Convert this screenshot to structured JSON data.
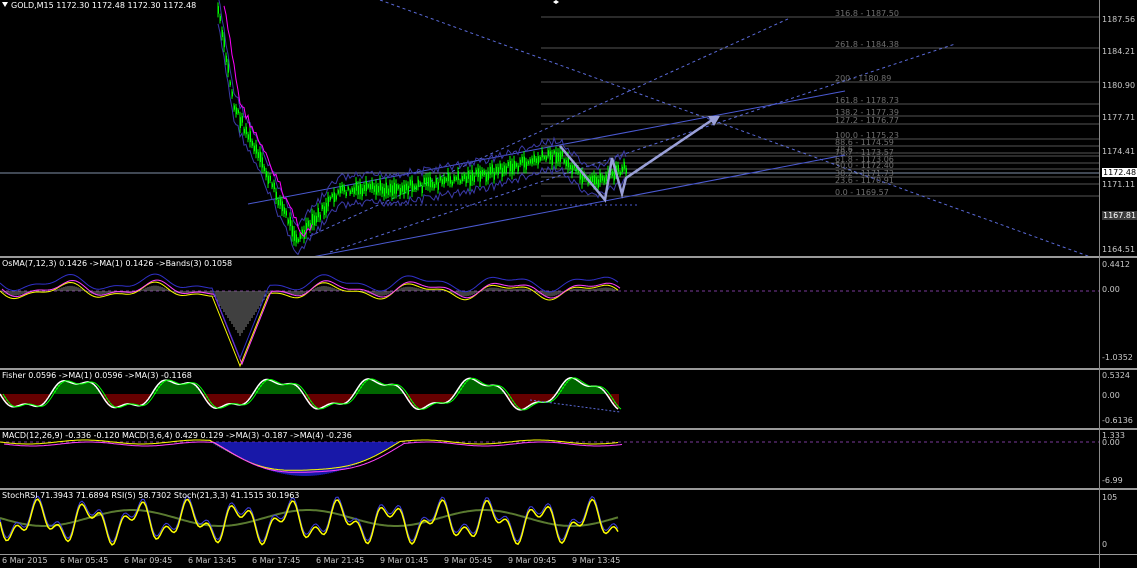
{
  "main": {
    "title": "GOLD,M15  1172.30 1172.48 1172.30 1172.48",
    "price_axis": [
      "1187.56",
      "1184.21",
      "1180.90",
      "1177.71",
      "1174.41",
      "1171.11",
      "1167.81",
      "1164.51"
    ],
    "current_price": "1172.48",
    "fib_levels": [
      "316.8 - 1187.50",
      "261.8 - 1184.38",
      "200 - 1180.89",
      "161.8 - 1178.73",
      "138.2 - 1177.39",
      "127.2 - 1176.77",
      "100.0 - 1175.23",
      "88.6 - 1174.59",
      "78.6",
      "70.7 - 1173.57",
      "61.8 - 1173.06",
      "50.0 - 1172.40",
      "38.2 - 1171.73",
      "23.6 - 1170.91",
      "0.0 - 1169.57"
    ]
  },
  "osma": {
    "title": "OsMA(7,12,3) 0.1426  ->MA(1) 0.1426  ->Bands(3) 0.1058",
    "axis": [
      "0.4412",
      "0.00",
      "-1.0352"
    ]
  },
  "fisher": {
    "title": "Fisher 0.0596  ->MA(1) 0.0596  ->MA(3) -0.1168",
    "axis": [
      "0.5324",
      "0.00",
      "-0.6136"
    ]
  },
  "macd": {
    "title": "MACD(12,26,9) -0.336 -0.120  MACD(3,6,4) 0.429 0.129  ->MA(3) -0.187  ->MA(4) -0.236",
    "axis": [
      "1.333",
      "0.00",
      "-6.99"
    ]
  },
  "stoch": {
    "title": "StochRSI 71.3943 71.6894  RSI(5) 58.7302  Stoch(21,3,3) 41.1515 30.1963",
    "axis": [
      "105",
      "0"
    ]
  },
  "time_axis": [
    "6 Mar 2015",
    "6 Mar 05:45",
    "6 Mar 09:45",
    "6 Mar 13:45",
    "6 Mar 17:45",
    "6 Mar 21:45",
    "9 Mar 01:45",
    "9 Mar 05:45",
    "9 Mar 09:45",
    "9 Mar 13:45"
  ],
  "colors": {
    "background": "#000000",
    "candle": "#00ff00",
    "trendline": "#4b5ad2",
    "fib": "#6e6e6e",
    "ma_magenta": "#ff00ff",
    "stoch_yellow": "#ffff00"
  }
}
